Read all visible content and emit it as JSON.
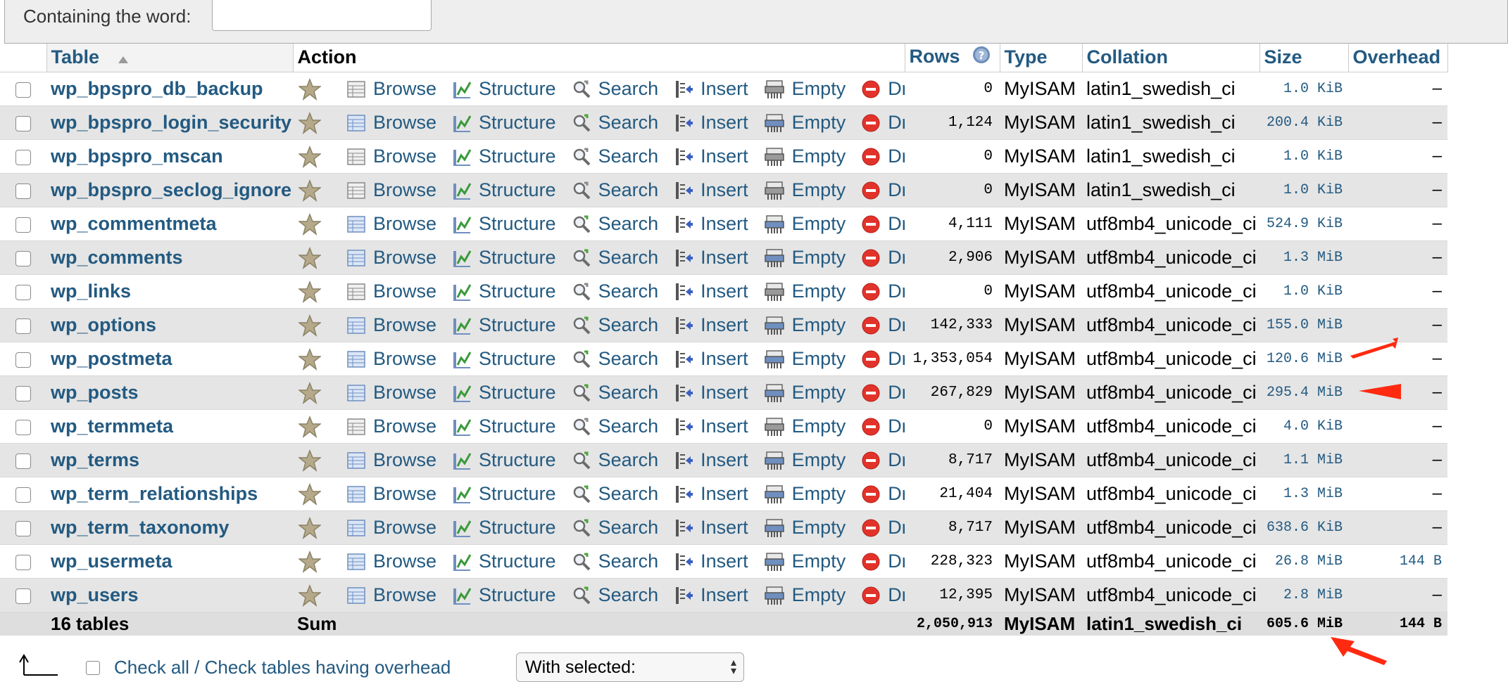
{
  "filter": {
    "label": "Containing the word:",
    "value": ""
  },
  "headers": {
    "table": "Table",
    "action": "Action",
    "rows": "Rows",
    "type": "Type",
    "collation": "Collation",
    "size": "Size",
    "overhead": "Overhead"
  },
  "actions": {
    "browse": "Browse",
    "structure": "Structure",
    "search": "Search",
    "insert": "Insert",
    "empty": "Empty",
    "drop": "Drop"
  },
  "tables": [
    {
      "name": "wp_bpspro_db_backup",
      "rows": "0",
      "type": "MyISAM",
      "collation": "latin1_swedish_ci",
      "size": "1.0 KiB",
      "overhead": "–",
      "empty": true
    },
    {
      "name": "wp_bpspro_login_security",
      "rows": "1,124",
      "type": "MyISAM",
      "collation": "latin1_swedish_ci",
      "size": "200.4 KiB",
      "overhead": "–",
      "empty": false
    },
    {
      "name": "wp_bpspro_mscan",
      "rows": "0",
      "type": "MyISAM",
      "collation": "latin1_swedish_ci",
      "size": "1.0 KiB",
      "overhead": "–",
      "empty": true
    },
    {
      "name": "wp_bpspro_seclog_ignore",
      "rows": "0",
      "type": "MyISAM",
      "collation": "latin1_swedish_ci",
      "size": "1.0 KiB",
      "overhead": "–",
      "empty": true
    },
    {
      "name": "wp_commentmeta",
      "rows": "4,111",
      "type": "MyISAM",
      "collation": "utf8mb4_unicode_ci",
      "size": "524.9 KiB",
      "overhead": "–",
      "empty": false
    },
    {
      "name": "wp_comments",
      "rows": "2,906",
      "type": "MyISAM",
      "collation": "utf8mb4_unicode_ci",
      "size": "1.3 MiB",
      "overhead": "–",
      "empty": false
    },
    {
      "name": "wp_links",
      "rows": "0",
      "type": "MyISAM",
      "collation": "utf8mb4_unicode_ci",
      "size": "1.0 KiB",
      "overhead": "–",
      "empty": true
    },
    {
      "name": "wp_options",
      "rows": "142,333",
      "type": "MyISAM",
      "collation": "utf8mb4_unicode_ci",
      "size": "155.0 MiB",
      "overhead": "–",
      "empty": false
    },
    {
      "name": "wp_postmeta",
      "rows": "1,353,054",
      "type": "MyISAM",
      "collation": "utf8mb4_unicode_ci",
      "size": "120.6 MiB",
      "overhead": "–",
      "empty": false
    },
    {
      "name": "wp_posts",
      "rows": "267,829",
      "type": "MyISAM",
      "collation": "utf8mb4_unicode_ci",
      "size": "295.4 MiB",
      "overhead": "–",
      "empty": false
    },
    {
      "name": "wp_termmeta",
      "rows": "0",
      "type": "MyISAM",
      "collation": "utf8mb4_unicode_ci",
      "size": "4.0 KiB",
      "overhead": "–",
      "empty": true
    },
    {
      "name": "wp_terms",
      "rows": "8,717",
      "type": "MyISAM",
      "collation": "utf8mb4_unicode_ci",
      "size": "1.1 MiB",
      "overhead": "–",
      "empty": false
    },
    {
      "name": "wp_term_relationships",
      "rows": "21,404",
      "type": "MyISAM",
      "collation": "utf8mb4_unicode_ci",
      "size": "1.3 MiB",
      "overhead": "–",
      "empty": false
    },
    {
      "name": "wp_term_taxonomy",
      "rows": "8,717",
      "type": "MyISAM",
      "collation": "utf8mb4_unicode_ci",
      "size": "638.6 KiB",
      "overhead": "–",
      "empty": false
    },
    {
      "name": "wp_usermeta",
      "rows": "228,323",
      "type": "MyISAM",
      "collation": "utf8mb4_unicode_ci",
      "size": "26.8 MiB",
      "overhead": "144 B",
      "empty": false
    },
    {
      "name": "wp_users",
      "rows": "12,395",
      "type": "MyISAM",
      "collation": "utf8mb4_unicode_ci",
      "size": "2.8 MiB",
      "overhead": "–",
      "empty": false
    }
  ],
  "footer": {
    "count": "16 tables",
    "sum": "Sum",
    "rows": "2,050,913",
    "type": "MyISAM",
    "collation": "latin1_swedish_ci",
    "size": "605.6 MiB",
    "overhead": "144 B"
  },
  "bottom": {
    "check_all": "Check all",
    "separator": " / ",
    "check_overhead": "Check tables having overhead",
    "with_selected": "With selected:"
  },
  "colors": {
    "link": "#235a81",
    "row_alt": "#e5e5e5",
    "annotation": "#ff2a10"
  }
}
